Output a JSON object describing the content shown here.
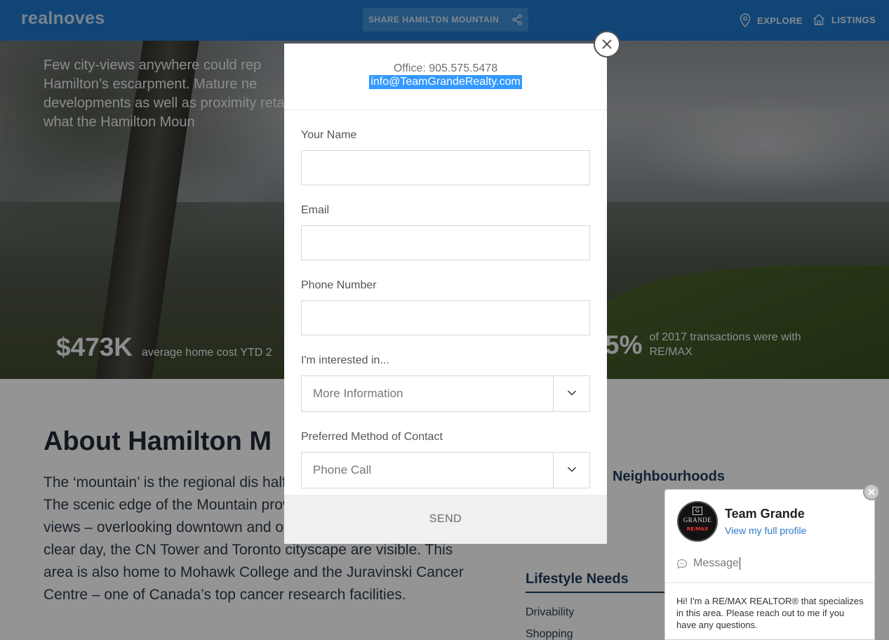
{
  "header": {
    "logo": "realnoves",
    "share_label": "SHARE HAMILTON MOUNTAIN",
    "nav": [
      {
        "label": "EXPLORE",
        "icon": "map-pin-icon"
      },
      {
        "label": "LISTINGS",
        "icon": "house-icon"
      }
    ]
  },
  "hero": {
    "intro": "Few city-views anywhere could rep Hamilton’s escarpment. Mature ne developments as well as proximity retail are what the Hamilton Moun",
    "stat_cost_value": "$473K",
    "stat_cost_label": "average home cost YTD 2",
    "stat_remax_value": "5%",
    "stat_remax_label": "of 2017 transactions were with RE/MAX"
  },
  "content": {
    "title": "About Hamilton M",
    "body": "The ‘mountain’ is the regional dis half of the city that rests on top o The scenic edge of the Mountain provinces most stunning urban views – overlooking downtown and out over Lake Ontario. On a clear day, the CN Tower and Toronto cityscape are visible. This area is also home to Mohawk College and the Juravinski Cancer Centre – one of Canada’s top cancer research facilities.",
    "side_heading_1": "Neighbourhoods",
    "side_heading_2": "Lifestyle Needs",
    "lifestyle_items": [
      "Drivability",
      "Shopping"
    ]
  },
  "modal": {
    "office": "Office: 905.575.5478",
    "email": "info@TeamGrandeRealty.com",
    "fields": {
      "name_label": "Your Name",
      "email_label": "Email",
      "phone_label": "Phone Number",
      "interest_label": "I'm interested in...",
      "interest_value": "More Information",
      "contact_label": "Preferred Method of Contact",
      "contact_value": "Phone Call"
    },
    "send_label": "SEND"
  },
  "chat": {
    "agent_name": "Team Grande",
    "profile_link": "View my full profile",
    "avatar_text": "GRANDE",
    "avatar_badge": "RE/MAX",
    "message_placeholder": "Message",
    "intro": "Hi! I'm a RE/MAX REALTOR® that specializes in this area. Please reach out to me if you have any questions."
  },
  "colors": {
    "header_bg": "#1e77cc",
    "email_highlight": "#3399ff",
    "link": "#2a7ac9"
  }
}
